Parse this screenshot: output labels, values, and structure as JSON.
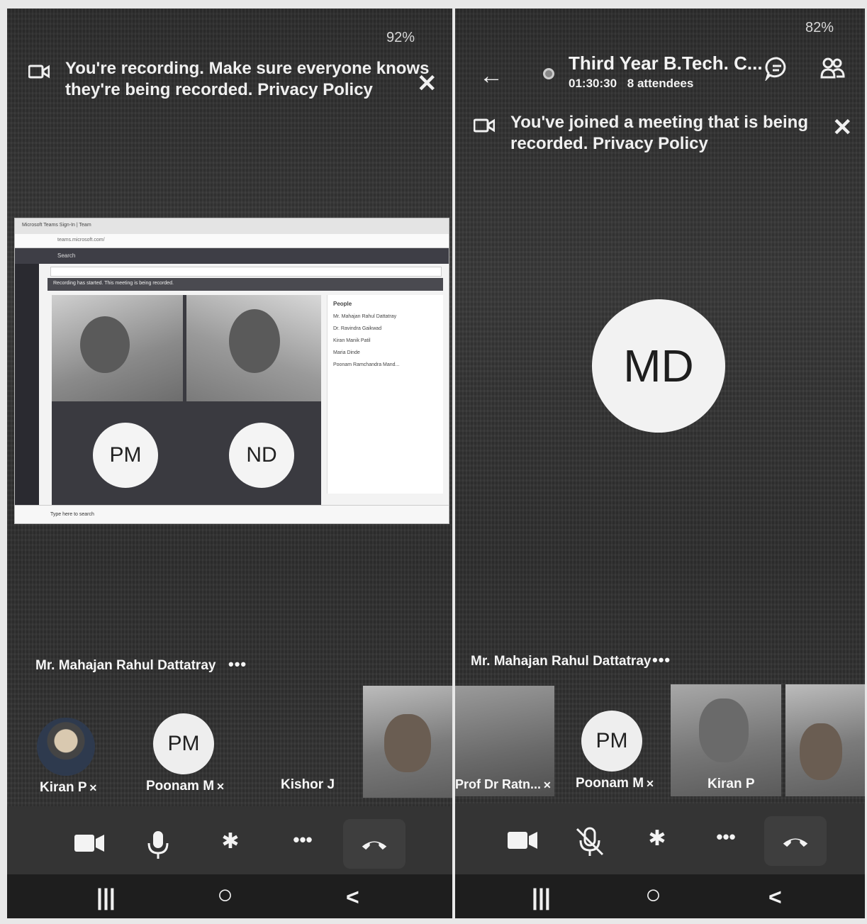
{
  "left": {
    "battery": "92%",
    "banner": {
      "line1": "You're recording. Make sure everyone knows",
      "line2": "they're being recorded. Privacy Policy"
    },
    "shared_screen": {
      "tab_text": "Microsoft Teams Sign-In | Team",
      "url_text": "teams.microsoft.com/",
      "search_placeholder": "Search",
      "recording_notice": "Recording has started. This meeting is being recorded.",
      "people_title": "People",
      "participant_initials": [
        "PM",
        "ND"
      ],
      "people_rows": [
        "Mr. Mahajan Rahul Dattatray",
        "Dr. Ravindra Gaikwad",
        "Kiran Manik Patil",
        "Maria Dinde",
        "Poonam Ramchandra Mand..."
      ],
      "taskbar_search": "Type here to search"
    },
    "speaker": "Mr. Mahajan Rahul Dattatray",
    "more": "•••",
    "tiles": [
      {
        "name": "Kiran P",
        "muted": true
      },
      {
        "name": "Poonam M",
        "initials": "PM",
        "muted": true
      },
      {
        "name": "Kishor J",
        "muted": false
      }
    ]
  },
  "right": {
    "battery": "82%",
    "title": "Third Year B.Tech. C...",
    "duration": "01:30:30",
    "attendees": "8 attendees",
    "banner": {
      "line1": "You've joined a meeting that is being",
      "line2": "recorded. Privacy Policy"
    },
    "main_initials": "MD",
    "speaker": "Mr. Mahajan Rahul Dattatray",
    "more": "•••",
    "tiles": [
      {
        "name": "Prof Dr Ratn...",
        "muted": true
      },
      {
        "name": "Poonam M",
        "initials": "PM",
        "muted": true
      },
      {
        "name": "Kiran P",
        "muted": false
      }
    ]
  },
  "icons": {
    "close": "✕",
    "back": "←",
    "mic": "🎤",
    "bluetooth": "✱",
    "more": "•••",
    "nav_recent": "|||",
    "nav_home": "○",
    "nav_back": "<",
    "mute_mark": "✕"
  }
}
